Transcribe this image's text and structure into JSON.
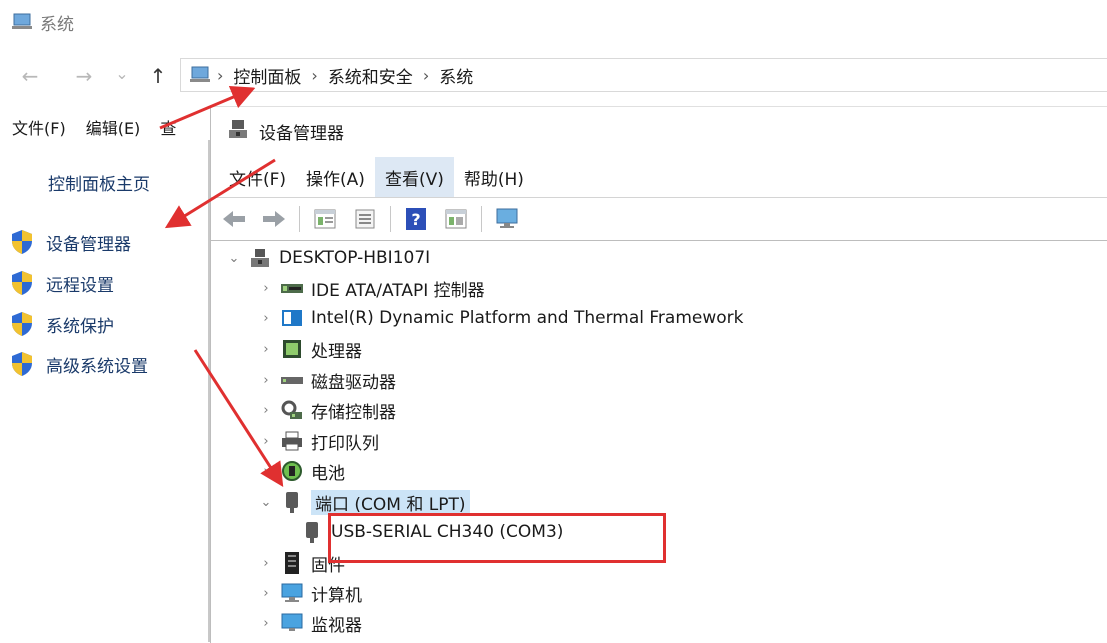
{
  "system_window": {
    "title": "系统",
    "nav": {
      "back": "←",
      "forward": "→",
      "recent": "⌄",
      "up": "↑"
    },
    "breadcrumb": [
      "控制面板",
      "系统和安全",
      "系统"
    ],
    "breadcrumb_sep": "›",
    "menu": [
      "文件(F)",
      "编辑(E)",
      "查"
    ],
    "sidebar_home": "控制面板主页",
    "sidebar_links": [
      "设备管理器",
      "远程设置",
      "系统保护",
      "高级系统设置"
    ]
  },
  "device_manager": {
    "title": "设备管理器",
    "menu": [
      "文件(F)",
      "操作(A)",
      "查看(V)",
      "帮助(H)"
    ],
    "active_menu": "查看(V)",
    "toolbar_icons": [
      "back-icon",
      "forward-icon",
      "properties-icon",
      "list-icon",
      "help-icon",
      "view-icon",
      "monitor-scan-icon"
    ],
    "computer": "DESKTOP-HBI107I",
    "categories": [
      {
        "label": "IDE ATA/ATAPI 控制器",
        "icon": "ide-controller-icon",
        "expanded": false
      },
      {
        "label": "Intel(R) Dynamic Platform and Thermal Framework",
        "icon": "intel-framework-icon",
        "expanded": false
      },
      {
        "label": "处理器",
        "icon": "processor-icon",
        "expanded": false
      },
      {
        "label": "磁盘驱动器",
        "icon": "disk-drive-icon",
        "expanded": false
      },
      {
        "label": "存储控制器",
        "icon": "storage-controller-icon",
        "expanded": false
      },
      {
        "label": "打印队列",
        "icon": "print-queue-icon",
        "expanded": false
      },
      {
        "label": "电池",
        "icon": "battery-icon",
        "expanded": false
      },
      {
        "label": "端口 (COM 和 LPT)",
        "icon": "port-icon",
        "expanded": true
      },
      {
        "label": "固件",
        "icon": "firmware-icon",
        "expanded": false
      },
      {
        "label": "计算机",
        "icon": "computer-icon",
        "expanded": false
      },
      {
        "label": "监视器",
        "icon": "monitor-icon",
        "expanded": false
      }
    ],
    "port_child": "USB-SERIAL CH340 (COM3)"
  },
  "colors": {
    "annotation_red": "#e03030",
    "selection": "#cce4f7",
    "link": "#1a3a6a"
  }
}
